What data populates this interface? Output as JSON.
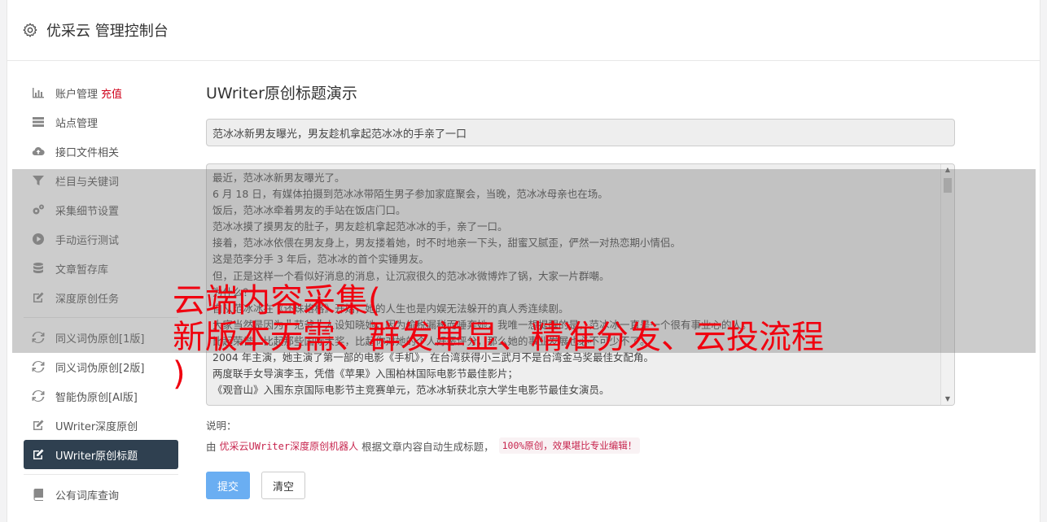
{
  "header": {
    "title": "优采云 管理控制台",
    "icon": "gear-icon"
  },
  "sidebar": {
    "items": [
      {
        "label": "账户管理",
        "extra": "充值",
        "icon": "bar-chart-icon"
      },
      {
        "label": "站点管理",
        "icon": "server-icon"
      },
      {
        "label": "接口文件相关",
        "icon": "cloud-upload-icon"
      },
      {
        "label": "栏目与关键词",
        "icon": "filter-icon"
      },
      {
        "label": "采集细节设置",
        "icon": "cogs-icon"
      },
      {
        "label": "手动运行测试",
        "icon": "play-circle-icon"
      },
      {
        "label": "文章暂存库",
        "icon": "database-icon"
      },
      {
        "label": "深度原创任务",
        "icon": "edit-icon"
      }
    ],
    "items2": [
      {
        "label": "同义词伪原创[1版]",
        "icon": "refresh-icon"
      },
      {
        "label": "同义词伪原创[2版]",
        "icon": "refresh-icon"
      },
      {
        "label": "智能伪原创[AI版]",
        "icon": "refresh-icon"
      },
      {
        "label": "UWriter深度原创",
        "icon": "edit-icon"
      },
      {
        "label": "UWriter原创标题",
        "icon": "edit-icon",
        "active": true
      }
    ],
    "items3": [
      {
        "label": "公有词库查询",
        "icon": "book-icon"
      }
    ]
  },
  "main": {
    "title": "UWriter原创标题演示",
    "title_value": "范冰冰新男友曝光，男友趁机拿起范冰冰的手亲了一口",
    "content_lines": [
      "最近，范冰冰新男友曝光了。",
      "6 月 18 日，有媒体拍摄到范冰冰带陌生男子参加家庭聚会，当晚，范冰冰母亲也在场。",
      "饭后，范冰冰牵着男友的手站在饭店门口。",
      "范冰冰摸了摸男友的肚子，男友趁机拿起范冰冰的手，亲了一口。",
      "接着，范冰冰依偎在男友身上，男友搂着她，时不时地亲一下头，甜蜜又腻歪，俨然一对热恋期小情侣。",
      "这是范李分手 3 年后，范冰冰的首个实锤男友。",
      "但，正是这样一个看似好消息的消息，让沉寂很久的范冰冰微博炸了锅，大家一片群嘲。",
      "为什么？",
      "自从范冰冰在《还珠格格》开始，她的人生也是内娱无法躲开的真人秀连续剧。",
      "大家当然是因为＂范爷＂人设知晓她，因为偷税漏税而唾弃她，我唯一想提醒的是，范冰冰一直是一个很有事业心的人。",
      "比起荣誉，比起那些国际大奖，比起你对她的个人好恶评分，那么她的事业发展也必不可少不了。",
      "2004 年主演，她主演了第一部的电影《手机》，在台湾获得小三武月不是台湾金马奖最佳女配角。",
      "两度联手女导演李玉，凭借《苹果》入围柏林国际电影节最佳影片；",
      "《观音山》入围东京国际电影节主竞赛单元，范冰冰斩获北京大学生电影节最佳女演员。"
    ],
    "note_label": "说明：",
    "note_prefix": "由",
    "note_hl1": "优采云UWriter深度原创机器人",
    "note_mid": "根据文章内容自动生成标题，",
    "note_hl2": "100%原创，效果堪比专业编辑！",
    "submit_label": "提交",
    "clear_label": "清空"
  },
  "watermark": "云端内容采集(\n新版本无需、群发单显、精准分发、云投流程\n)",
  "colors": {
    "active_bg": "#2f4050",
    "accent": "#6aaef2",
    "highlight": "#c7254e",
    "watermark": "#f0000f"
  }
}
